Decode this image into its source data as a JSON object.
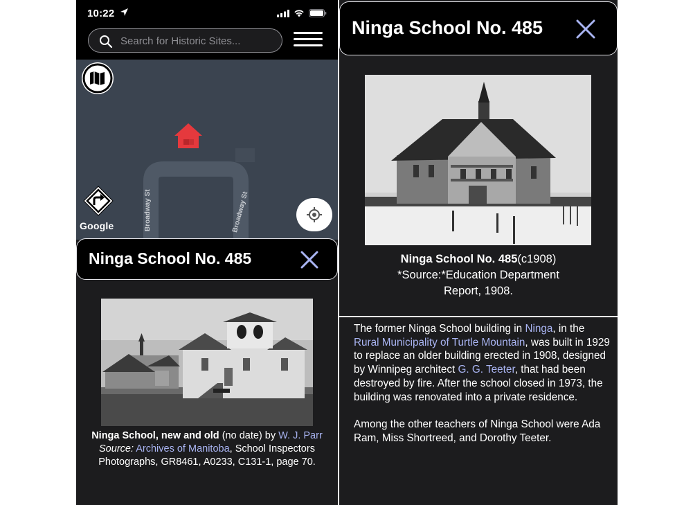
{
  "left_screen": {
    "status_bar": {
      "time": "10:22"
    },
    "search": {
      "placeholder": "Search for Historic Sites..."
    },
    "map": {
      "street_1": "Broadway St",
      "street_2": "Broadway St",
      "attribution": "Google"
    },
    "title": "Ninga School No. 485",
    "caption": {
      "title": "Ninga School, new and old",
      "date": "(no date)",
      "by": "by",
      "author_link": "W. J. Parr",
      "source_label": "Source:",
      "source_link": "Archives of Manitoba",
      "source_rest": ", School Inspectors Photographs, GR8461, A0233, C131-1, page 70."
    }
  },
  "right_screen": {
    "title": "Ninga School No. 485",
    "caption": {
      "title": "Ninga School No. 485",
      "date": "(c1908)",
      "source": "*Source:*Education Department Report, 1908."
    },
    "body": {
      "p1_a": "The former Ninga School building in ",
      "p1_link1": "Ninga",
      "p1_b": ", in the ",
      "p1_link2": "Rural Municipality of Turtle Mountain",
      "p1_c": ", was built in 1929 to replace an older building erected in 1908, designed by Winnipeg architect ",
      "p1_link3": "G. G. Teeter",
      "p1_d": ", that had been destroyed by fire. After the school closed in 1973, the building was renovated into a private residence.",
      "p2": "Among the other teachers of Ninga School were Ada Ram, Miss Shortreed, and Dorothy Teeter."
    }
  },
  "colors": {
    "link": "#a9b4f2",
    "panel_bg": "#1c1c1e",
    "map_bg": "#3b4450",
    "marker": "#e5393d"
  }
}
